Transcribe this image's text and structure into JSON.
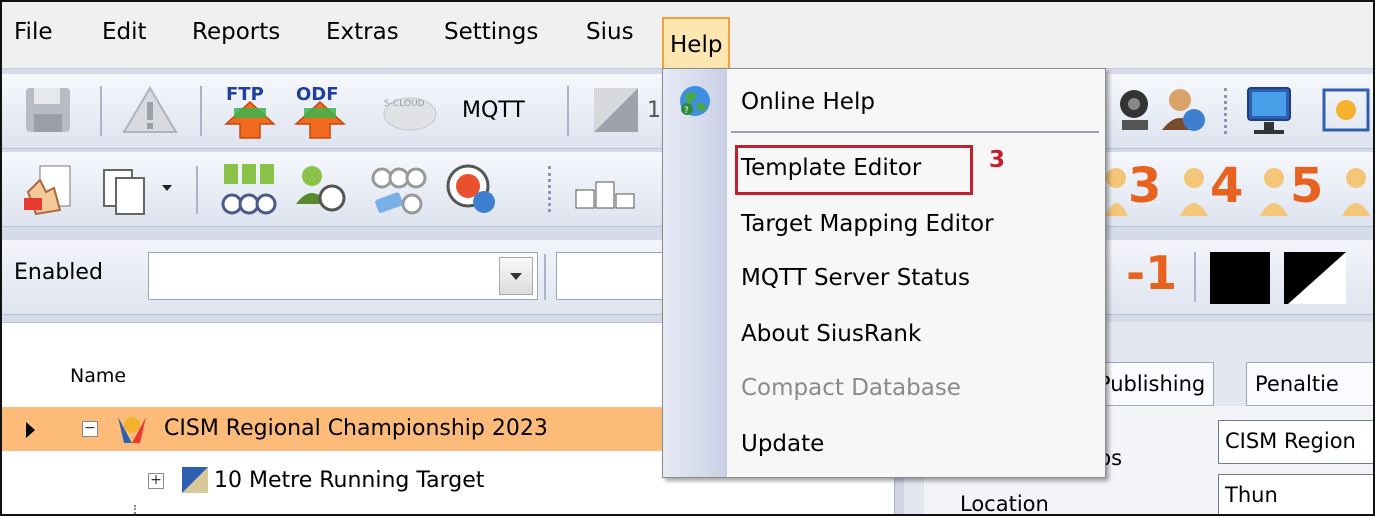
{
  "menubar": {
    "items": [
      "File",
      "Edit",
      "Reports",
      "Extras",
      "Settings",
      "Sius",
      "Help"
    ]
  },
  "toolbar1": {
    "mqtt_label": "MQTT",
    "ftp_label": "FTP",
    "odf_label": "ODF",
    "scloud_label": "S-CLOUD",
    "counter": "1"
  },
  "filterbar": {
    "enabled_label": "Enabled",
    "combo_value": "",
    "combo2_value": "",
    "minus_one": "-1"
  },
  "toolbar2": {
    "place_numbers": [
      "3",
      "4",
      "5"
    ]
  },
  "tree": {
    "header_name": "Name",
    "rows": [
      {
        "label": "CISM Regional Championship 2023"
      },
      {
        "label": "10 Metre Running Target"
      }
    ]
  },
  "right_panel": {
    "tabs": [
      "ne Publishing",
      "Penaltie"
    ],
    "fields": [
      {
        "label": "ips",
        "value": "CISM Region"
      },
      {
        "label": "Location",
        "value": "Thun"
      }
    ]
  },
  "help_menu": {
    "items": [
      {
        "label": "Online Help",
        "enabled": true
      },
      {
        "label": "Template Editor",
        "enabled": true
      },
      {
        "label": "Target Mapping Editor",
        "enabled": true
      },
      {
        "label": "MQTT Server Status",
        "enabled": true
      },
      {
        "label": "About SiusRank",
        "enabled": true
      },
      {
        "label": "Compact Database",
        "enabled": false
      },
      {
        "label": "Update",
        "enabled": true
      }
    ],
    "callout_number": "3"
  },
  "colors": {
    "selected_row": "#fdbb79",
    "highlight": "#c0202f",
    "menu_active_bg": "#fde7b0",
    "orange_numbers": "#e8621f"
  }
}
